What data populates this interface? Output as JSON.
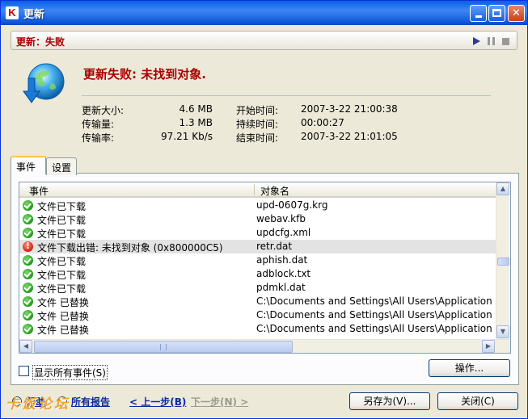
{
  "window": {
    "title": "更新",
    "app_icon_letter": "K"
  },
  "status": {
    "label": "更新：失败"
  },
  "main": {
    "heading": "更新失败: 未找到对象.",
    "stats": [
      {
        "label": "更新大小:",
        "value": "4.6 MB",
        "label2": "开始时间:",
        "value2": "2007-3-22 21:00:38"
      },
      {
        "label": "传输量:",
        "value": "1.3 MB",
        "label2": "持续时间:",
        "value2": "00:00:27"
      },
      {
        "label": "传输率:",
        "value": "97.21 Kb/s",
        "label2": "结束时间:",
        "value2": "2007-3-22 21:01:05"
      }
    ]
  },
  "tabs": [
    {
      "label": "事件",
      "active": true
    },
    {
      "label": "设置",
      "active": false
    }
  ],
  "list": {
    "columns": [
      "事件",
      "对象名"
    ],
    "rows": [
      {
        "status": "ok",
        "event": "文件已下载",
        "object": "upd-0607g.krg"
      },
      {
        "status": "ok",
        "event": "文件已下载",
        "object": "webav.kfb"
      },
      {
        "status": "ok",
        "event": "文件已下载",
        "object": "updcfg.xml"
      },
      {
        "status": "error",
        "event": "文件下载出错: 未找到对象 (0x800000C5)",
        "object": "retr.dat"
      },
      {
        "status": "ok",
        "event": "文件已下载",
        "object": "aphish.dat"
      },
      {
        "status": "ok",
        "event": "文件已下载",
        "object": "adblock.txt"
      },
      {
        "status": "ok",
        "event": "文件已下载",
        "object": "pdmkl.dat"
      },
      {
        "status": "ok",
        "event": "文件 已替换",
        "object": "C:\\Documents and Settings\\All Users\\Application Data\\"
      },
      {
        "status": "ok",
        "event": "文件 已替换",
        "object": "C:\\Documents and Settings\\All Users\\Application Data\\"
      },
      {
        "status": "ok",
        "event": "文件 已替换",
        "object": "C:\\Documents and Settings\\All Users\\Application Data\\"
      }
    ]
  },
  "options": {
    "show_all_events": "显示所有事件(S)",
    "show_all_checked": false
  },
  "buttons": {
    "operations": "操作...",
    "save_as": "另存为(V)...",
    "close": "关闭(C)"
  },
  "footer": {
    "help": "帮助",
    "all_reports": "所有报告",
    "prev": "< 上一步(B)",
    "next": "下一步(N) >",
    "watermark": "卡饭论坛"
  },
  "colors": {
    "accent_red": "#a80000",
    "link_blue": "#0a2a9e",
    "titlebar_blue": "#0a5fe4"
  }
}
